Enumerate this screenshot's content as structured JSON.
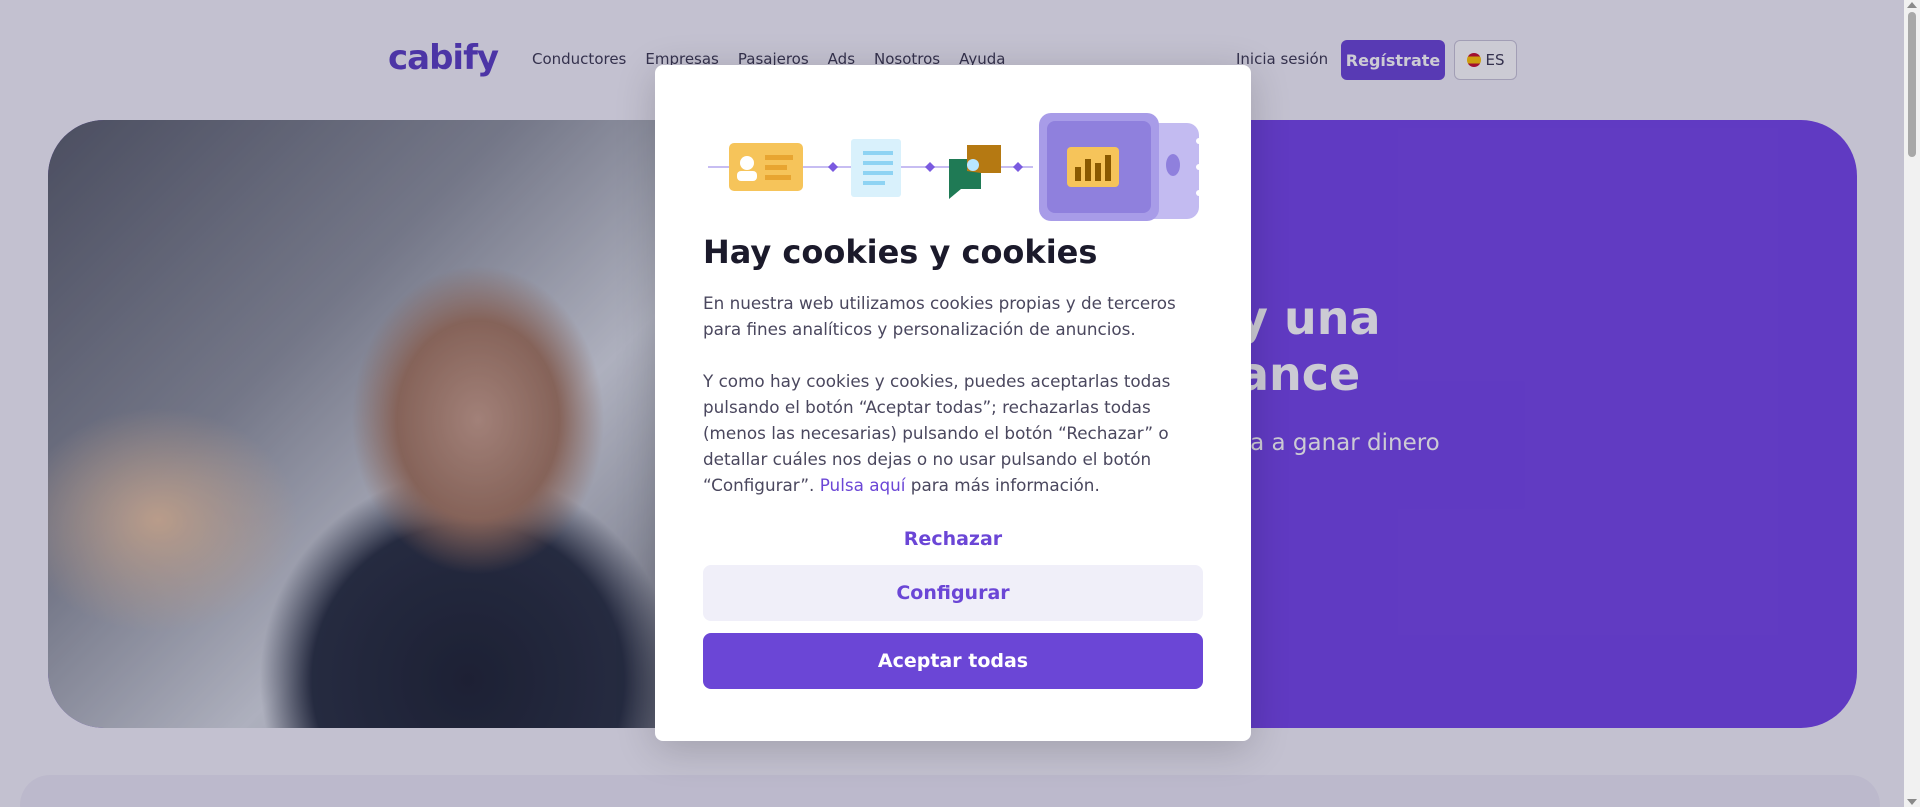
{
  "brand": {
    "logo": "cabify",
    "accent": "#6b46d6"
  },
  "nav": {
    "links": [
      "Conductores",
      "Empresas",
      "Pasajeros",
      "Ads",
      "Nosotros",
      "Ayuda"
    ],
    "login": "Inicia sesión",
    "signup": "Regístrate",
    "language": "ES"
  },
  "hero": {
    "title_line1": "y una",
    "title_line2": "ance",
    "subtitle": "za a ganar dinero"
  },
  "cookie_modal": {
    "title": "Hay cookies y cookies",
    "paragraph1": "En nuestra web utilizamos cookies propias y de terceros para fines analíticos y personalización de anuncios.",
    "paragraph2": "Y como hay cookies y cookies, puedes aceptarlas todas pulsando el botón “Aceptar todas”; rechazarlas todas (menos las necesarias) pulsando el botón “Rechazar” o detallar cuáles nos dejas o no usar pulsando el botón “Configurar”.",
    "link_text": "Pulsa aquí",
    "link_suffix": " para más información.",
    "reject_label": "Rechazar",
    "configure_label": "Configurar",
    "accept_label": "Aceptar todas"
  }
}
